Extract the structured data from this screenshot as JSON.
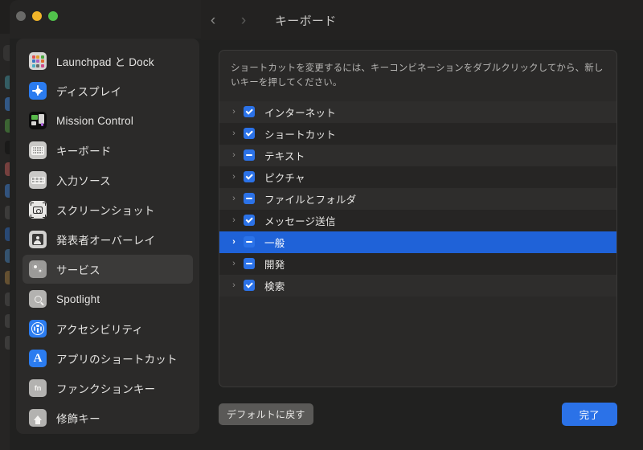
{
  "window": {
    "traffic_lights": [
      "close",
      "minimize",
      "zoom"
    ]
  },
  "topnav": {
    "back_icon": "chevron-left-icon",
    "back_glyph": "‹",
    "forward_icon": "chevron-right-icon",
    "forward_glyph": "›",
    "title": "キーボード"
  },
  "sidebar": {
    "items": [
      {
        "label": "Launchpad と Dock",
        "icon": "launchpad-dock-icon",
        "selected": false
      },
      {
        "label": "ディスプレイ",
        "icon": "display-icon",
        "selected": false
      },
      {
        "label": "Mission Control",
        "icon": "mission-control-icon",
        "selected": false
      },
      {
        "label": "キーボード",
        "icon": "keyboard-icon",
        "selected": false
      },
      {
        "label": "入力ソース",
        "icon": "input-sources-icon",
        "selected": false
      },
      {
        "label": "スクリーンショット",
        "icon": "screenshot-icon",
        "selected": false
      },
      {
        "label": "発表者オーバーレイ",
        "icon": "presenter-overlay-icon",
        "selected": false
      },
      {
        "label": "サービス",
        "icon": "services-icon",
        "selected": true
      },
      {
        "label": "Spotlight",
        "icon": "spotlight-icon",
        "selected": false
      },
      {
        "label": "アクセシビリティ",
        "icon": "accessibility-icon",
        "selected": false
      },
      {
        "label": "アプリのショートカット",
        "icon": "app-shortcuts-icon",
        "selected": false
      },
      {
        "label": "ファンクションキー",
        "icon": "function-keys-icon",
        "selected": false
      },
      {
        "label": "修飾キー",
        "icon": "modifier-keys-icon",
        "selected": false
      }
    ]
  },
  "main": {
    "hint": "ショートカットを変更するには、キーコンビネーションをダブルクリックしてから、新しいキーを押してください。",
    "rows": [
      {
        "label": "インターネット",
        "checkbox": "checked",
        "selected": false
      },
      {
        "label": "ショートカット",
        "checkbox": "checked",
        "selected": false
      },
      {
        "label": "テキスト",
        "checkbox": "indeterminate",
        "selected": false
      },
      {
        "label": "ピクチャ",
        "checkbox": "checked",
        "selected": false
      },
      {
        "label": "ファイルとフォルダ",
        "checkbox": "indeterminate",
        "selected": false
      },
      {
        "label": "メッセージ送信",
        "checkbox": "checked",
        "selected": false
      },
      {
        "label": "一般",
        "checkbox": "indeterminate",
        "selected": true
      },
      {
        "label": "開発",
        "checkbox": "indeterminate",
        "selected": false
      },
      {
        "label": "検索",
        "checkbox": "checked",
        "selected": false
      }
    ],
    "disclosure_glyph": "›"
  },
  "footer": {
    "reset_label": "デフォルトに戻す",
    "done_label": "完了"
  },
  "colors": {
    "accent_blue": "#2b72e8",
    "selection_blue": "#1f62d8",
    "window_bg": "#212120",
    "sidebar_bg": "#2b2a29",
    "panel_bg": "#2a2928"
  },
  "background_window": {
    "icon_colors": [
      "#3d7f8a",
      "#3a78c4",
      "#4a8a3e",
      "#141414",
      "#a8504f",
      "#3a6fb5",
      "#4a4948",
      "#2b5fa8",
      "#3f6f9e",
      "#8a6a3a",
      "#4a4948",
      "#4a4948",
      "#4a4948"
    ]
  }
}
